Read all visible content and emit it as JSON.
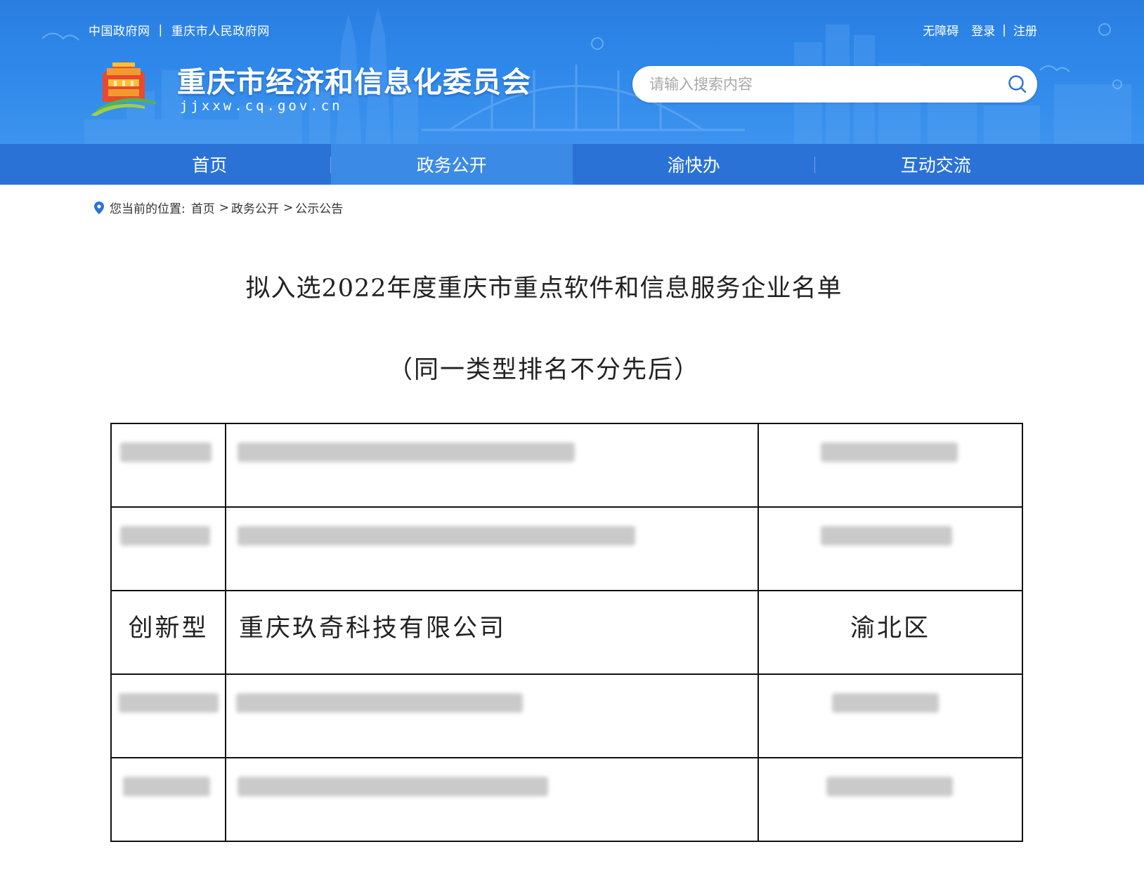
{
  "top_links": {
    "gov_cn": "中国政府网",
    "separator": "|",
    "cq_gov": "重庆市人民政府网"
  },
  "user_links": {
    "accessibility": "无障碍",
    "login": "登录",
    "separator": "|",
    "register": "注册"
  },
  "site": {
    "title": "重庆市经济和信息化委员会",
    "domain": "jjxxw.cq.gov.cn"
  },
  "search": {
    "placeholder": "请输入搜索内容",
    "value": ""
  },
  "nav": {
    "items": [
      {
        "label": "首页",
        "active": false
      },
      {
        "label": "政务公开",
        "active": true
      },
      {
        "label": "渝快办",
        "active": false
      },
      {
        "label": "互动交流",
        "active": false
      }
    ]
  },
  "breadcrumb": {
    "prefix": "您当前的位置:",
    "items": [
      "首页",
      "政务公开",
      "公示公告"
    ],
    "arrow": ">"
  },
  "document": {
    "title": "拟入选2022年度重庆市重点软件和信息服务企业名单",
    "subtitle": "（同一类型排名不分先后）",
    "rows": [
      {
        "type": "",
        "company": "",
        "district": "",
        "blurred": true
      },
      {
        "type": "",
        "company": "",
        "district": "",
        "blurred": true
      },
      {
        "type": "创新型",
        "company": "重庆玖奇科技有限公司",
        "district": "渝北区",
        "blurred": false
      },
      {
        "type": "",
        "company": "",
        "district": "",
        "blurred": true
      },
      {
        "type": "",
        "company": "",
        "district": "",
        "blurred": true
      }
    ]
  },
  "colors": {
    "banner": "#2e88ea",
    "navbar": "#2a72d6",
    "nav_active": "#3b8ae6",
    "breadcrumb_pin": "#2a72d6"
  }
}
